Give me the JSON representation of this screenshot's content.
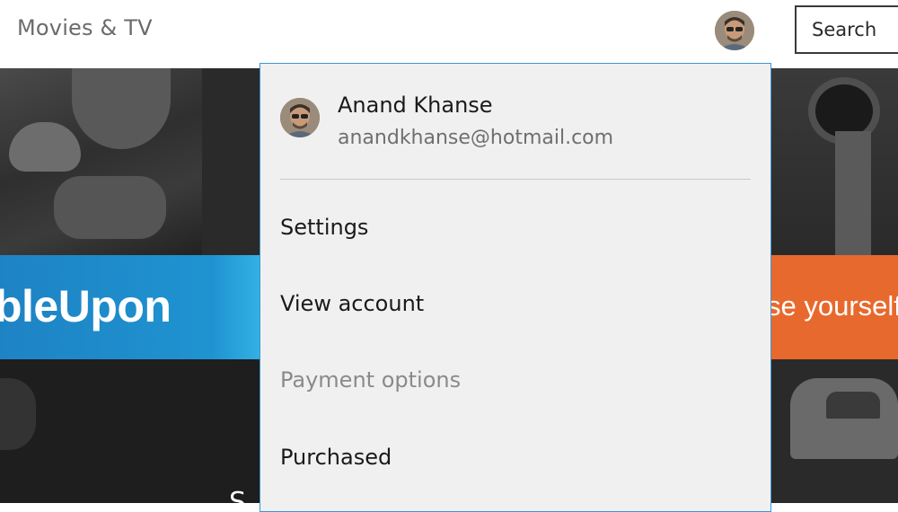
{
  "app": {
    "title": "Movies & TV"
  },
  "header": {
    "search_label": "Search"
  },
  "account_menu": {
    "user_name": "Anand Khanse",
    "user_email": "anandkhanse@hotmail.com",
    "items": [
      {
        "label": "Settings",
        "enabled": true
      },
      {
        "label": "View account",
        "enabled": true
      },
      {
        "label": "Payment options",
        "enabled": false
      },
      {
        "label": "Purchased",
        "enabled": true
      }
    ]
  },
  "background": {
    "left_banner_text": "bleUpon",
    "right_banner_text": "se yourself",
    "partial_bottom_text": "S"
  },
  "colors": {
    "accent_border": "#3c96d6",
    "flyout_bg": "#f0f0f0",
    "banner_blue": "#1f93d1",
    "banner_orange": "#e8692d"
  },
  "icons": {
    "avatar": "user-avatar-icon"
  }
}
